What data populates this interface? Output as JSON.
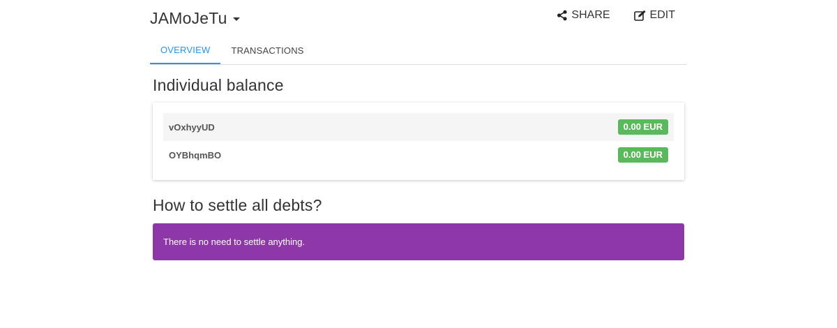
{
  "header": {
    "group_name": "JAMoJeTu",
    "actions": {
      "share_label": "SHARE",
      "edit_label": "EDIT"
    }
  },
  "tabs": [
    {
      "label": "OVERVIEW",
      "active": true
    },
    {
      "label": "TRANSACTIONS",
      "active": false
    }
  ],
  "individual_balance": {
    "title": "Individual balance",
    "rows": [
      {
        "name": "vOxhyyUD",
        "amount": "0.00 EUR"
      },
      {
        "name": "OYBhqmBO",
        "amount": "0.00 EUR"
      }
    ]
  },
  "settle": {
    "title": "How to settle all debts?",
    "message": "There is no need to settle anything."
  },
  "colors": {
    "accent": "#2196f3",
    "badge_positive": "#5cb85c",
    "settle_box": "#8e37a8",
    "row_stripe": "#f5f5f5"
  },
  "icons": {
    "share": "share-icon",
    "edit": "edit-icon",
    "dropdown": "caret-down-icon"
  }
}
